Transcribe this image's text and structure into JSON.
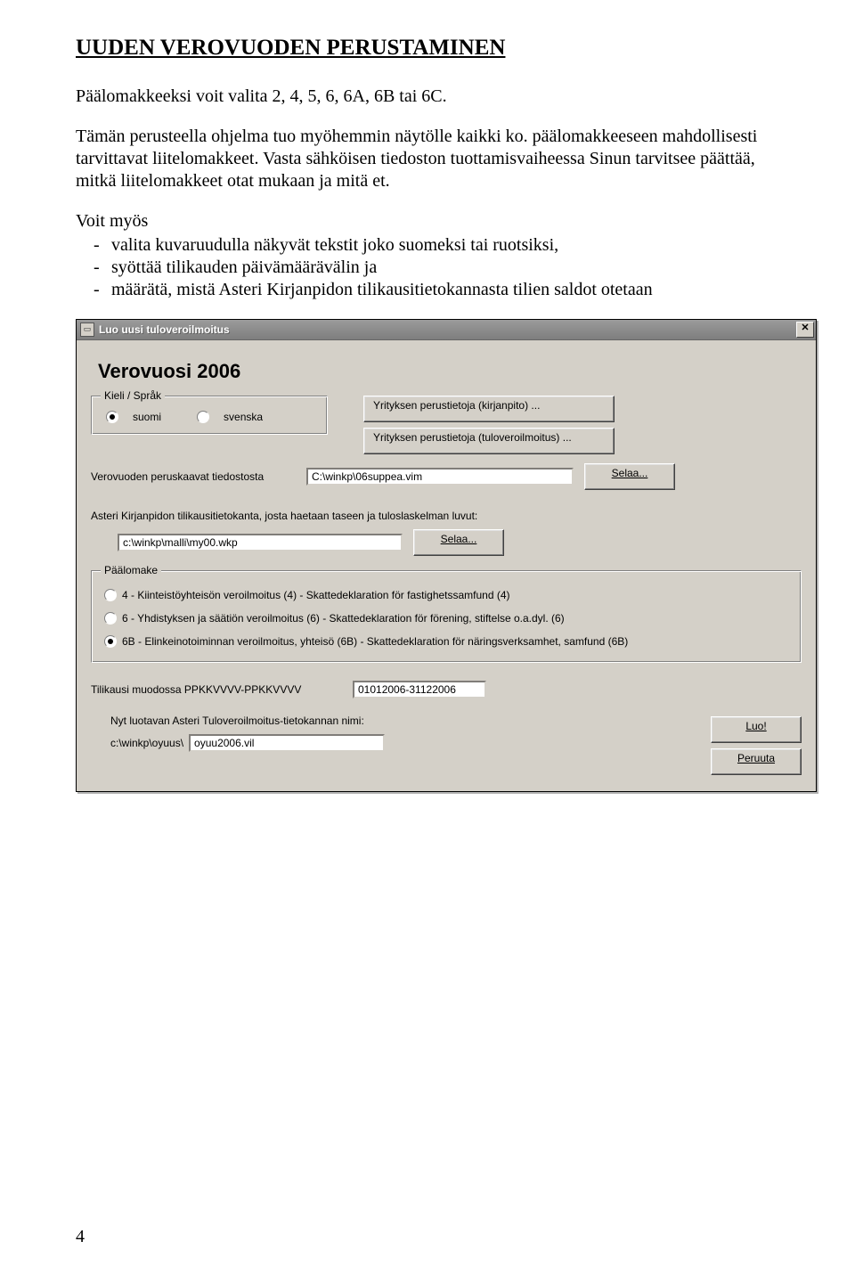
{
  "doc": {
    "heading": "UUDEN VEROVUODEN PERUSTAMINEN",
    "para1": "Päälomakkeeksi voit valita 2, 4, 5, 6, 6A, 6B tai 6C.",
    "para2": "Tämän perusteella ohjelma tuo myöhemmin näytölle kaikki ko. päälomakkeeseen mahdollisesti tarvittavat liitelomakkeet. Vasta sähköisen tiedoston tuottamisvaiheessa Sinun tarvitsee päättää, mitkä liitelomakkeet otat mukaan ja mitä et.",
    "bullets_lead": "Voit myös",
    "bullets": [
      "valita kuvaruudulla näkyvät tekstit joko suomeksi tai ruotsiksi,",
      "syöttää tilikauden päivämäärävälin ja",
      "määrätä, mistä Asteri Kirjanpidon tilikausitietokannasta tilien saldot otetaan"
    ],
    "page_number": "4"
  },
  "dialog": {
    "title": "Luo uusi tuloveroilmoitus",
    "close_glyph": "✕",
    "year_label": "Verovuosi 2006",
    "lang": {
      "legend": "Kieli / Språk",
      "fi": "suomi",
      "sv": "svenska",
      "selected": "fi"
    },
    "btn_company_kp": "Yrityksen perustietoja (kirjanpito) ...",
    "btn_company_tvi": "Yrityksen perustietoja (tuloveroilmoitus) ...",
    "kaavat_label": "Verovuoden peruskaavat tiedostosta",
    "kaavat_value": "C:\\winkp\\06suppea.vim",
    "selaa": "Selaa...",
    "kp_db_label": "Asteri Kirjanpidon tilikausitietokanta, josta haetaan taseen ja tuloslaskelman luvut:",
    "kp_db_value": "c:\\winkp\\malli\\my00.wkp",
    "paalomake": {
      "legend": "Päälomake",
      "opts": [
        "4 - Kiinteistöyhteisön veroilmoitus (4) - Skattedeklaration för fastighetssamfund (4)",
        "6 - Yhdistyksen ja säätiön veroilmoitus (6) - Skattedeklaration för förening, stiftelse o.a.dyl. (6)",
        "6B - Elinkeinotoiminnan veroilmoitus, yhteisö (6B) - Skattedeklaration för näringsverksamhet, samfund (6B)"
      ],
      "selected_index": 2
    },
    "tilikausi_label": "Tilikausi muodossa PPKKVVVV-PPKKVVVV",
    "tilikausi_value": "01012006-31122006",
    "out_label": "Nyt luotavan Asteri Tuloveroilmoitus-tietokannan nimi:",
    "out_path_prefix": "c:\\winkp\\oyuus\\",
    "out_filename": "oyuu2006.vil",
    "btn_luo": "Luo!",
    "btn_peruuta": "Peruuta"
  }
}
